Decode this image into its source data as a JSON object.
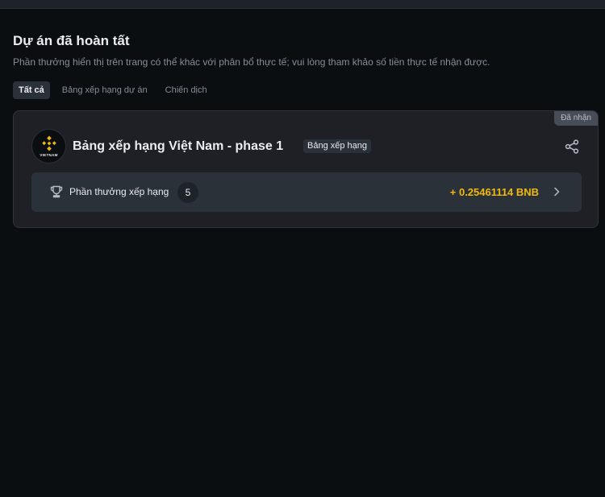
{
  "section": {
    "title": "Dự án đã hoàn tất",
    "subtitle": "Phần thưởng hiển thị trên trang có thể khác với phân bổ thực tế; vui lòng tham khảo số tiền thực tế nhận được."
  },
  "tabs": [
    {
      "label": "Tất cả",
      "active": true
    },
    {
      "label": "Bảng xếp hạng dự án",
      "active": false
    },
    {
      "label": "Chiến dịch",
      "active": false
    }
  ],
  "card": {
    "status_badge": "Đã nhận",
    "logo_text": "VIETNAM",
    "title": "Bảng xếp hạng Việt Nam - phase 1",
    "type_tag": "Bảng xếp hạng",
    "reward": {
      "label": "Phần thưởng xếp hạng",
      "rank": "5",
      "amount": "+ 0.25461114 BNB"
    },
    "icons": {
      "logo": "binance-logo-icon",
      "share": "share-icon",
      "trophy": "trophy-icon",
      "chevron": "chevron-right-icon"
    }
  },
  "colors": {
    "background": "#0b0e11",
    "card": "#1e2026",
    "accent": "#f0b90b",
    "text_primary": "#eaecef",
    "text_secondary": "#848e9c"
  }
}
